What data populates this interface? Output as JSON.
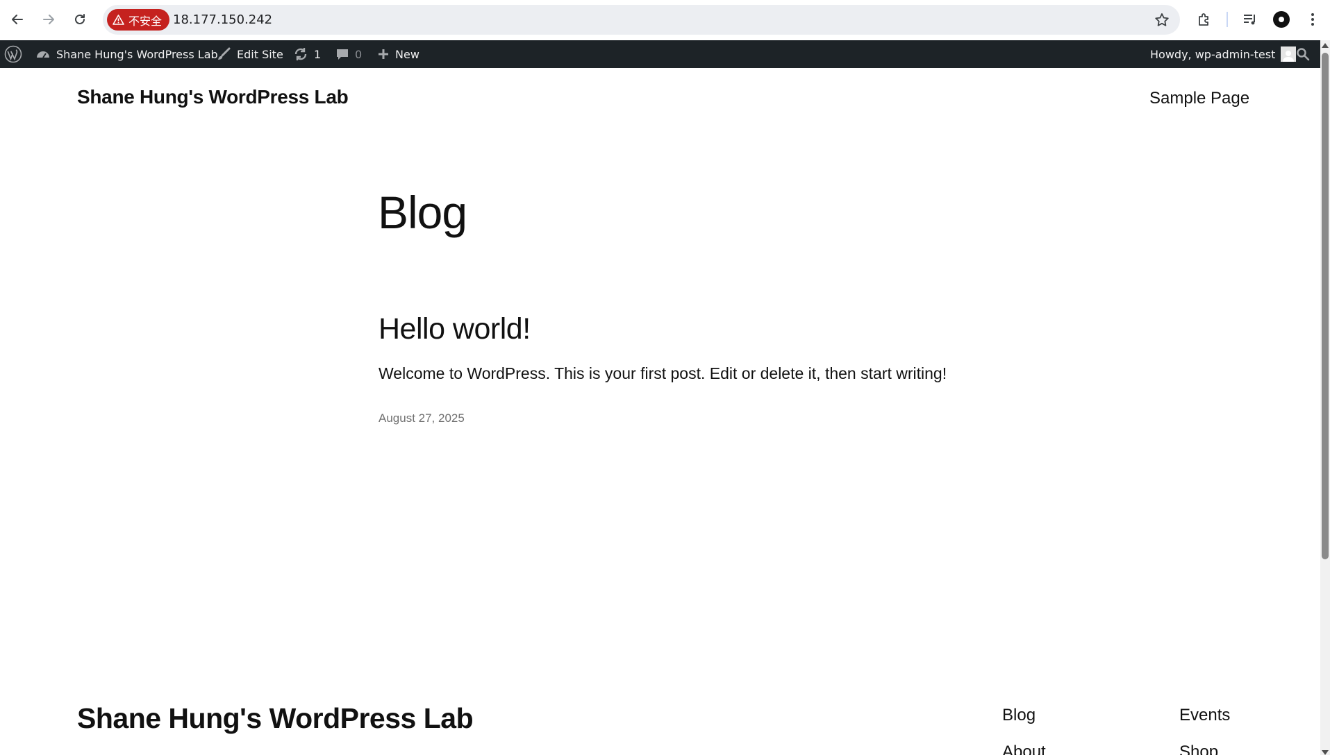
{
  "browser": {
    "security_label": "不安全",
    "url": "18.177.150.242"
  },
  "admin_bar": {
    "site_name": "Shane Hung's WordPress Lab",
    "edit_site": "Edit Site",
    "updates_count": "1",
    "comments_count": "0",
    "new_label": "New",
    "howdy": "Howdy, wp-admin-test"
  },
  "site": {
    "title": "Shane Hung's WordPress Lab",
    "nav": [
      "Sample Page"
    ]
  },
  "main": {
    "heading": "Blog",
    "posts": [
      {
        "title": "Hello world!",
        "excerpt": "Welcome to WordPress. This is your first post. Edit or delete it, then start writing!",
        "date": "August 27, 2025"
      }
    ]
  },
  "footer": {
    "title": "Shane Hung's WordPress Lab",
    "links_col1": [
      "Blog",
      "About"
    ],
    "links_col2": [
      "Events",
      "Shop"
    ]
  }
}
